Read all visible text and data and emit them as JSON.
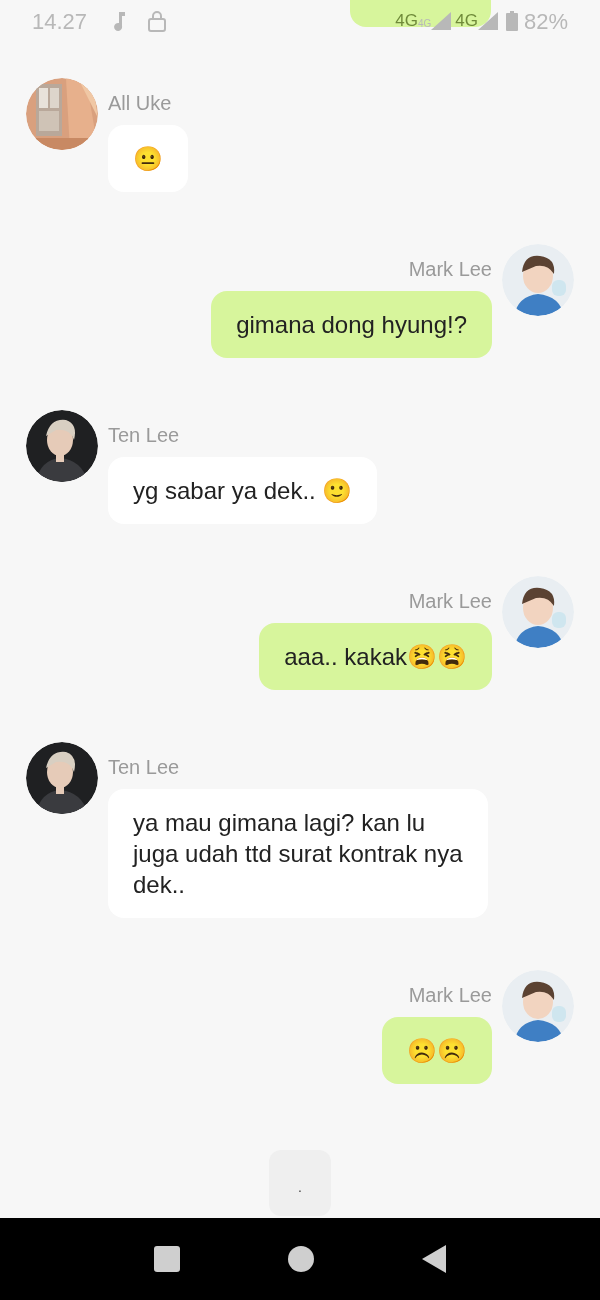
{
  "status_bar": {
    "time": "14.27",
    "signals": [
      {
        "label": "4G",
        "badge": "4G"
      },
      {
        "label": "4G"
      }
    ],
    "battery": "82%"
  },
  "cut_message": {
    "kind": "outgoing"
  },
  "messages": [
    {
      "kind": "incoming",
      "sender": "All Uke",
      "text": "😐"
    },
    {
      "kind": "outgoing",
      "sender": "Mark Lee",
      "text": "gimana dong hyung!?"
    },
    {
      "kind": "incoming",
      "sender": "Ten Lee",
      "text": "yg sabar ya dek.. 🙂"
    },
    {
      "kind": "outgoing",
      "sender": "Mark Lee",
      "text": "aaa.. kakak😫😫"
    },
    {
      "kind": "incoming",
      "sender": "Ten Lee",
      "text": "ya mau gimana lagi? kan lu juga udah ttd surat kontrak nya dek.."
    },
    {
      "kind": "outgoing",
      "sender": "Mark Lee",
      "text": "☹️☹️"
    }
  ],
  "typing": {
    "text": "."
  }
}
